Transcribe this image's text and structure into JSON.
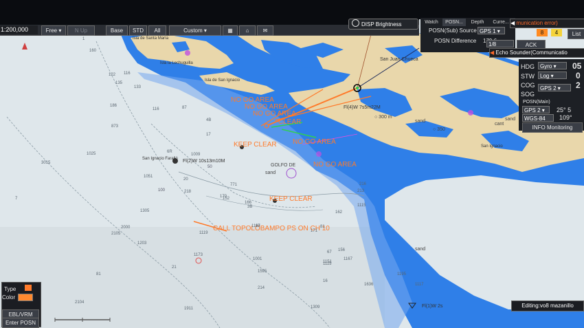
{
  "toolbar": {
    "scale": "1:200,000",
    "free": "Free",
    "north_up": "N Up",
    "base": "Base",
    "std": "STD",
    "all": "All",
    "custom": "Custom",
    "disp_brightness": "DISP Brightness"
  },
  "watch_panel": {
    "tabs": [
      "Watch",
      "POSN...",
      "Depth",
      "Curre..."
    ],
    "posn_sub_source_label": "POSN(Sub) Source",
    "posn_sub_source_value": "GPS 1",
    "posn_difference_label": "POSN Difference",
    "posn_difference_value": "179.6",
    "pager": "1/8",
    "ack": "ACK"
  },
  "alerts": {
    "alert1": "munication error)",
    "counter_a": "8",
    "counter_b": "4",
    "list": "List",
    "alert2": "Echo Sounder(Communicatio"
  },
  "nav": {
    "hdg_label": "HDG",
    "hdg_source": "Gyro",
    "hdg_value": "05",
    "stw_label": "STW",
    "stw_source": "Log",
    "stw_value": "0",
    "cog_label": "COG",
    "sog_label": "SOG",
    "cog_source": "GPS 2",
    "cog_value": "2",
    "posn_main_label": "POSN(Main)",
    "posn_source": "GPS 2",
    "lat": "25° 5",
    "datum": "WGS-84",
    "lon": "109°",
    "info_monitoring": "INFO Monitoring"
  },
  "bottom_left": {
    "type_label": "Type",
    "color_label": "Color",
    "ebl_vrm": "EBL/VRM",
    "enter_posn": "Enter POSN"
  },
  "editing": "Editing:vo8 mazanillo",
  "chart_annotations": {
    "no_go_1": "NO GO AREA",
    "no_go_2": "NO GO AREA",
    "no_go_3": "NO GO AREA",
    "no_go_4": "NO GO AREA",
    "no_go_5": "NO GO AREA",
    "clear": "CLEAR",
    "keep_clear_1": "KEEP CLEAR",
    "keep_clear_2": "KEEP CLEAR",
    "call": "CALL TOPOLOBAMPO PS ON CH 10"
  },
  "chart_labels": {
    "isla_santa_maria": "Isla de Santa María",
    "la_lechuguilla": "Isla la Lechuguilla",
    "isla_de_san_ignacio": "Isla de San Ignacio",
    "san_juan_chueca": "San Juan Chueca",
    "san_ignacio_farallon": "San Ignacio Faralló",
    "light_1": "Fl(2)W 10s13m10M",
    "light_2": "Fl(4)W 7s5m22M",
    "light_3": "Fl(1)W 2s",
    "golfo": "GOLFO DE",
    "sand_1": "sand",
    "sand_2": "sand",
    "sand_3": "sand",
    "sand_4": "sand",
    "cant": "cant",
    "h300": "○ 300 m",
    "h350": "○ 350",
    "san_ignacio_e": "San Ignacio",
    "contour_50": "50",
    "contour_100": "100"
  },
  "depths": [
    "1",
    "160",
    "116",
    "133",
    "122",
    "135",
    "186",
    "873",
    "1025",
    "1305",
    "1051",
    "3015",
    "2000",
    "2105",
    "1119",
    "1173",
    "1115",
    "7",
    "2104",
    "1911",
    "1595",
    "1309",
    "1636",
    "1117",
    "1195",
    "1167",
    "1151",
    "1115",
    "6R",
    "20",
    "17",
    "87",
    "4B",
    "1009",
    "771",
    "166",
    "170",
    "152",
    "216",
    "213",
    "162",
    "171",
    "81",
    "67",
    "16",
    "156",
    "1203",
    "1001",
    "1119",
    "21",
    "3B",
    "67",
    "116",
    "218",
    "214",
    "81"
  ],
  "colors": {
    "sea_shallow": "#2f7fe8",
    "sea_deep": "#dfe8ec",
    "land": "#e9d7ab",
    "annotation": "#ff7a2a",
    "panel": "#1d2025"
  }
}
